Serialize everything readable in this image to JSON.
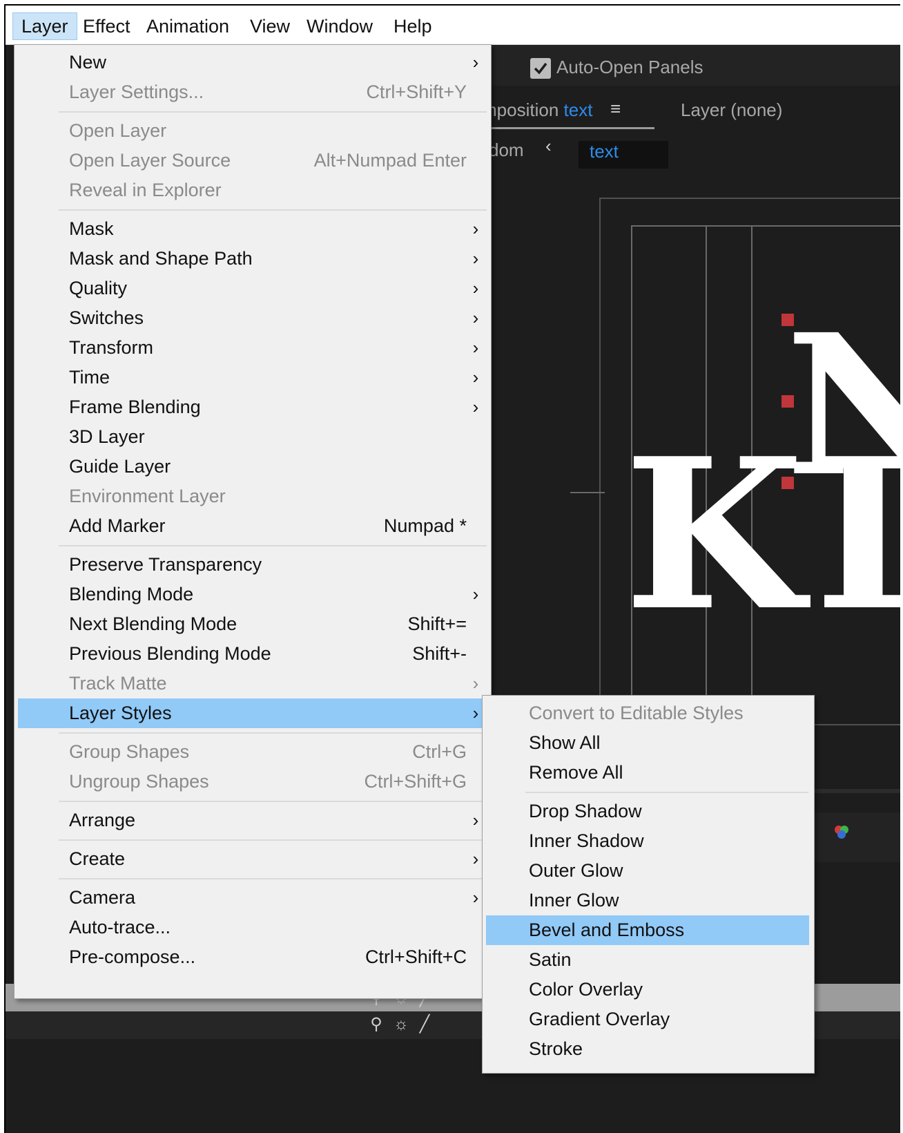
{
  "menubar": {
    "items": [
      {
        "label": "Layer"
      },
      {
        "label": "Effect"
      },
      {
        "label": "Animation"
      },
      {
        "label": "View"
      },
      {
        "label": "Window"
      },
      {
        "label": "Help"
      }
    ]
  },
  "background": {
    "auto_open_panels": "Auto-Open Panels",
    "comp_tab_prefix": "mposition",
    "comp_tab_name": "text",
    "comp_tab_menu": "≡",
    "layer_tab": "Layer  (none)",
    "crumb_prev": "dom",
    "crumb_arrow": "‹",
    "crumb_current": "text",
    "letters": [
      "K",
      "N",
      "I"
    ],
    "switch_icons": [
      "solo-shy",
      "sun",
      "slash"
    ]
  },
  "layer_menu": {
    "new": "New",
    "layer_settings": "Layer Settings...",
    "layer_settings_sc": "Ctrl+Shift+Y",
    "open_layer": "Open Layer",
    "open_layer_source": "Open Layer Source",
    "open_layer_source_sc": "Alt+Numpad Enter",
    "reveal_in_explorer": "Reveal in Explorer",
    "mask": "Mask",
    "mask_and_shape_path": "Mask and Shape Path",
    "quality": "Quality",
    "switches": "Switches",
    "transform": "Transform",
    "time": "Time",
    "frame_blending": "Frame Blending",
    "three_d_layer": "3D Layer",
    "guide_layer": "Guide Layer",
    "environment_layer": "Environment Layer",
    "add_marker": "Add Marker",
    "add_marker_sc": "Numpad *",
    "preserve_transparency": "Preserve Transparency",
    "blending_mode": "Blending Mode",
    "next_blending_mode": "Next Blending Mode",
    "next_blending_mode_sc": "Shift+=",
    "previous_blending_mode": "Previous Blending Mode",
    "previous_blending_mode_sc": "Shift+-",
    "track_matte": "Track Matte",
    "layer_styles": "Layer Styles",
    "group_shapes": "Group Shapes",
    "group_shapes_sc": "Ctrl+G",
    "ungroup_shapes": "Ungroup Shapes",
    "ungroup_shapes_sc": "Ctrl+Shift+G",
    "arrange": "Arrange",
    "create": "Create",
    "camera": "Camera",
    "auto_trace": "Auto-trace...",
    "pre_compose": "Pre-compose...",
    "pre_compose_sc": "Ctrl+Shift+C",
    "arrow": "›"
  },
  "layer_styles_menu": {
    "convert": "Convert to Editable Styles",
    "show_all": "Show All",
    "remove_all": "Remove All",
    "drop_shadow": "Drop Shadow",
    "inner_shadow": "Inner Shadow",
    "outer_glow": "Outer Glow",
    "inner_glow": "Inner Glow",
    "bevel_and_emboss": "Bevel and Emboss",
    "satin": "Satin",
    "color_overlay": "Color Overlay",
    "gradient_overlay": "Gradient Overlay",
    "stroke": "Stroke"
  },
  "colors": {
    "highlight": "#91c9f7",
    "menu_bg": "#f0f0f0",
    "app_bg": "#1d1d1d",
    "accent_blue": "#2d8ceb",
    "handle_red": "#c0363a"
  }
}
